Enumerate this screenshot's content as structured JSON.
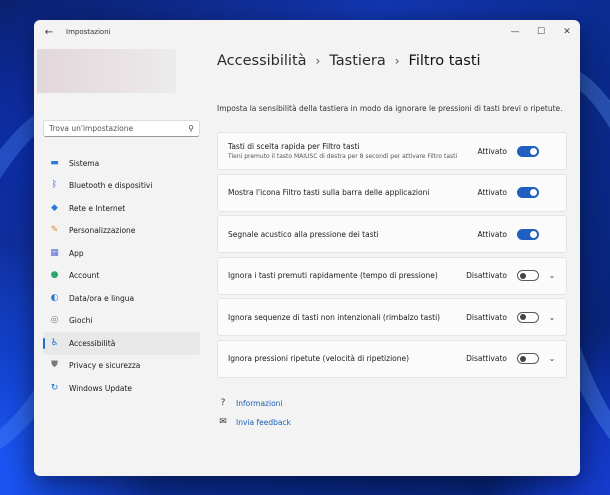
{
  "window": {
    "title": "Impostazioni",
    "controls": [
      "minimize",
      "maximize",
      "close"
    ]
  },
  "sidebar": {
    "search_placeholder": "Trova un'impostazione",
    "items": [
      {
        "label": "Sistema",
        "icon": "monitor-icon",
        "color": "#2b7bd6"
      },
      {
        "label": "Bluetooth e dispositivi",
        "icon": "bluetooth-icon",
        "color": "#1a73d9"
      },
      {
        "label": "Rete e Internet",
        "icon": "wifi-icon",
        "color": "#2b7bd6"
      },
      {
        "label": "Personalizzazione",
        "icon": "brush-icon",
        "color": "#e08a3a"
      },
      {
        "label": "App",
        "icon": "apps-icon",
        "color": "#5a6ad6"
      },
      {
        "label": "Account",
        "icon": "person-icon",
        "color": "#2ea36a"
      },
      {
        "label": "Data/ora e lingua",
        "icon": "globe-clock-icon",
        "color": "#2b7bd6"
      },
      {
        "label": "Giochi",
        "icon": "gamepad-icon",
        "color": "#777777"
      },
      {
        "label": "Accessibilità",
        "icon": "accessibility-icon",
        "color": "#1a6fd1",
        "active": true
      },
      {
        "label": "Privacy e sicurezza",
        "icon": "shield-icon",
        "color": "#7a7a7a"
      },
      {
        "label": "Windows Update",
        "icon": "update-icon",
        "color": "#1a6fd1"
      }
    ]
  },
  "breadcrumb": {
    "items": [
      "Accessibilità",
      "Tastiera"
    ],
    "current": "Filtro tasti"
  },
  "description": "Imposta la sensibilità della tastiera in modo da ignorare le pressioni di tasti brevi o ripetute.",
  "settings": [
    {
      "title": "Tasti di scelta rapida per Filtro tasti",
      "subtitle": "Tieni premuto il tasto MAIUSC di destra per 8 secondi per attivare Filtro tasti",
      "status": "Attivato",
      "on": true,
      "expandable": false
    },
    {
      "title": "Mostra l'icona Filtro tasti sulla barra delle applicazioni",
      "subtitle": "",
      "status": "Attivato",
      "on": true,
      "expandable": false
    },
    {
      "title": "Segnale acustico alla pressione dei tasti",
      "subtitle": "",
      "status": "Attivato",
      "on": true,
      "expandable": false
    },
    {
      "title": "Ignora i tasti premuti rapidamente (tempo di pressione)",
      "subtitle": "",
      "status": "Disattivato",
      "on": false,
      "expandable": true
    },
    {
      "title": "Ignora sequenze di tasti non intenzionali (rimbalzo tasti)",
      "subtitle": "",
      "status": "Disattivato",
      "on": false,
      "expandable": true
    },
    {
      "title": "Ignora pressioni ripetute (velocità di ripetizione)",
      "subtitle": "",
      "status": "Disattivato",
      "on": false,
      "expandable": true
    }
  ],
  "links": [
    {
      "label": "Informazioni",
      "icon": "help-chat-icon"
    },
    {
      "label": "Invia feedback",
      "icon": "feedback-icon"
    }
  ],
  "colors": {
    "accent": "#1f5fbf",
    "link": "#1a5fb4",
    "window_bg": "#f3f3f3"
  }
}
